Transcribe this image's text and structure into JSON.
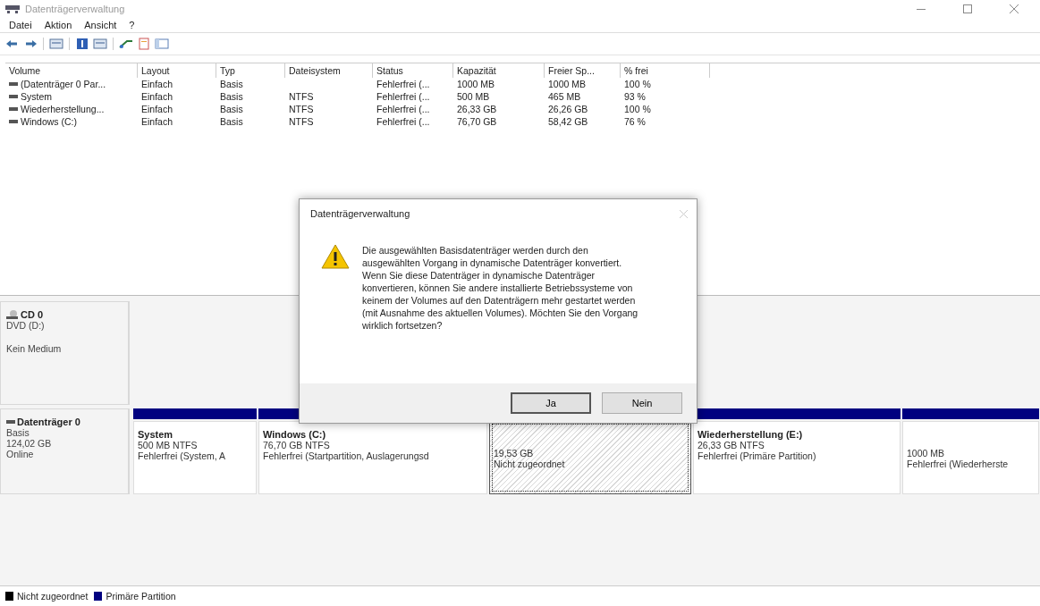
{
  "window": {
    "title": "Datenträgerverwaltung"
  },
  "menu": [
    "Datei",
    "Aktion",
    "Ansicht",
    "?"
  ],
  "volumes": {
    "columns": [
      "Volume",
      "Layout",
      "Typ",
      "Dateisystem",
      "Status",
      "Kapazität",
      "Freier Sp...",
      "% frei"
    ],
    "rows": [
      {
        "cells": [
          "(Datenträger 0 Par...",
          "Einfach",
          "Basis",
          "",
          "Fehlerfrei (...",
          "1000 MB",
          "1000 MB",
          "100 %"
        ]
      },
      {
        "cells": [
          "System",
          "Einfach",
          "Basis",
          "NTFS",
          "Fehlerfrei (...",
          "500 MB",
          "465 MB",
          "93 %"
        ]
      },
      {
        "cells": [
          "Wiederherstellung...",
          "Einfach",
          "Basis",
          "NTFS",
          "Fehlerfrei (...",
          "26,33 GB",
          "26,26 GB",
          "100 %"
        ]
      },
      {
        "cells": [
          "Windows (C:)",
          "Einfach",
          "Basis",
          "NTFS",
          "Fehlerfrei (...",
          "76,70 GB",
          "58,42 GB",
          "76 %"
        ]
      }
    ]
  },
  "disks": [
    {
      "kind": "cdrom",
      "name": "CD 0",
      "lines": [
        "DVD (D:)",
        "Kein Medium"
      ]
    },
    {
      "kind": "disk",
      "name": "Datenträger 0",
      "lines": [
        "Basis",
        "124,02 GB",
        "Online"
      ],
      "partitions": [
        {
          "kind": "primary",
          "title": "System",
          "size": "500 MB NTFS",
          "status": "Fehlerfrei (System, A",
          "selected": false
        },
        {
          "kind": "primary",
          "title": "Windows (C:)",
          "size": "76,70 GB NTFS",
          "status": "Fehlerfrei (Startpartition, Auslagerungsd",
          "selected": false
        },
        {
          "kind": "unallocated",
          "size": "19,53 GB",
          "status": "Nicht zugeordnet",
          "selected": true
        },
        {
          "kind": "primary",
          "title": "Wiederherstellung  (E:)",
          "size": "26,33 GB NTFS",
          "status": "Fehlerfrei (Primäre Partition)",
          "selected": false
        },
        {
          "kind": "primary",
          "size": "1000 MB",
          "status": "Fehlerfrei (Wiederherste",
          "selected": false
        }
      ]
    }
  ],
  "legend": [
    {
      "label": "Nicht zugeordnet",
      "color": "#000000"
    },
    {
      "label": "Primäre Partition",
      "color": "#000080"
    }
  ],
  "dialog": {
    "title": "Datenträgerverwaltung",
    "message": "Die ausgewählten Basisdatenträger werden durch den ausgewählten Vorgang in dynamische Datenträger konvertiert. Wenn Sie diese Datenträger in dynamische Datenträger konvertieren, können Sie andere installierte Betriebssysteme von keinem der Volumes auf den Datenträgern mehr gestartet werden (mit Ausnahme des aktuellen Volumes). Möchten Sie den Vorgang wirklich fortsetzen?",
    "buttons": [
      {
        "label": "Ja",
        "default": true
      },
      {
        "label": "Nein",
        "default": false
      }
    ]
  }
}
